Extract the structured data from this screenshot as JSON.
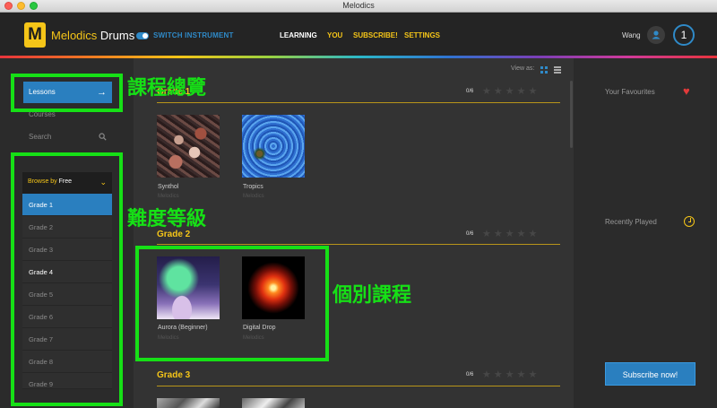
{
  "window": {
    "title": "Melodics"
  },
  "header": {
    "logo_letter": "M",
    "brand_name": "Melodics",
    "brand_product": "Drums",
    "switch_label": "SWITCH INSTRUMENT",
    "nav": [
      {
        "label": "LEARNING",
        "color": "#ffffff"
      },
      {
        "label": "YOU",
        "color": "#f5c518"
      },
      {
        "label": "SUBSCRIBE!",
        "color": "#f5c518"
      },
      {
        "label": "SETTINGS",
        "color": "#f5c518"
      }
    ],
    "username": "Wang",
    "level": "1"
  },
  "sidebar": {
    "lessons_label": "Lessons",
    "courses_label": "Courses",
    "search_label": "Search",
    "browse_prefix": "Browse by",
    "browse_value": "Free",
    "grades": [
      "Grade 1",
      "Grade 2",
      "Grade 3",
      "Grade 4",
      "Grade 5",
      "Grade 6",
      "Grade 7",
      "Grade 8",
      "Grade 9"
    ]
  },
  "content": {
    "view_as_label": "View as:",
    "sections": [
      {
        "title": "Grade 1",
        "progress": "0/6",
        "lessons": [
          {
            "title": "Synthol",
            "author": "Melodics"
          },
          {
            "title": "Tropics",
            "author": "Melodics"
          }
        ]
      },
      {
        "title": "Grade 2",
        "progress": "0/6",
        "lessons": [
          {
            "title": "Aurora (Beginner)",
            "author": "Melodics"
          },
          {
            "title": "Digital Drop",
            "author": "Melodics"
          }
        ]
      },
      {
        "title": "Grade 3",
        "progress": "0/6",
        "lessons": []
      }
    ]
  },
  "right_panel": {
    "favourites_label": "Your Favourites",
    "recently_played_label": "Recently Played",
    "subscribe_label": "Subscribe now!"
  },
  "annotations": {
    "course_overview": "課程總覽",
    "difficulty_level": "難度等級",
    "individual_course": "個別課程"
  },
  "colors": {
    "accent_blue": "#2a7fbf",
    "accent_yellow": "#f5c518",
    "annotation_green": "#16e016"
  },
  "icons": [
    "arrow-right-icon",
    "search-icon",
    "chevron-down-icon",
    "user-icon",
    "grid-view-icon",
    "list-view-icon",
    "star-icon",
    "heart-icon",
    "clock-icon"
  ]
}
